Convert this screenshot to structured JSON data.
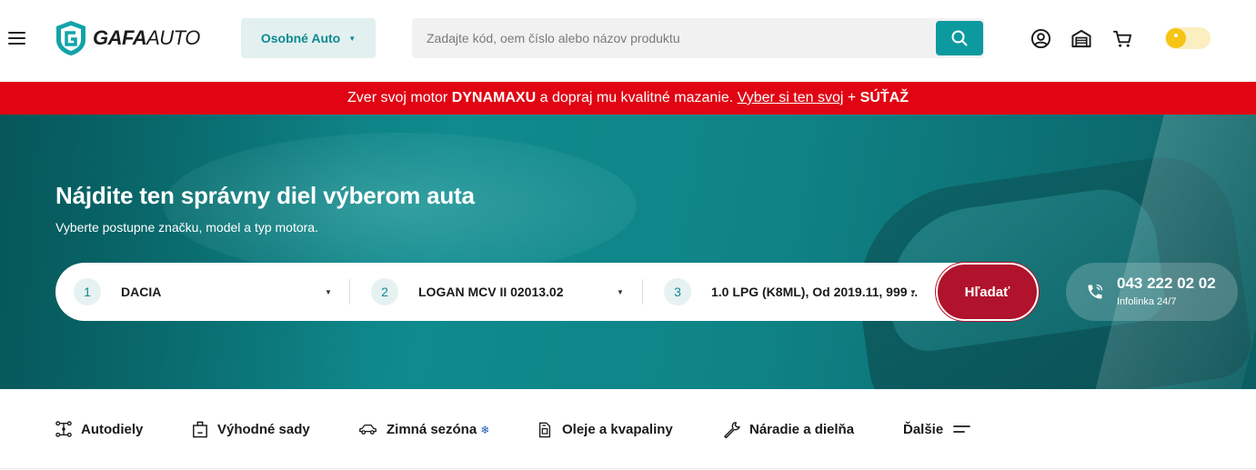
{
  "header": {
    "logo": {
      "bold": "GAFA",
      "thin": "AUTO"
    },
    "vehicle_type": "Osobné Auto",
    "search_placeholder": "Zadajte kód, oem číslo alebo názov produktu",
    "icons": [
      "menu-icon",
      "user-icon",
      "garage-icon",
      "cart-icon",
      "theme-toggle"
    ]
  },
  "promo": {
    "pre": "Zver svoj motor ",
    "brand": "DYNAMAXU",
    "mid": " a dopraj mu kvalitné mazanie. ",
    "link": "Vyber si ten svoj",
    "plus": " + ",
    "contest": "SÚŤAŽ"
  },
  "hero": {
    "title": "Nájdite ten správny diel výberom auta",
    "subtitle": "Vyberte postupne značku, model a typ motora.",
    "steps": [
      {
        "num": "1",
        "value": "DACIA"
      },
      {
        "num": "2",
        "value": "LOGAN MCV II 02013.02"
      },
      {
        "num": "3",
        "value": "1.0 LPG (K8ML), Od 2019.11, 999 ..."
      }
    ],
    "search_button": "Hľadať",
    "phone": {
      "number": "043 222 02 02",
      "label": "Infolinka 24/7"
    }
  },
  "categories": [
    {
      "label": "Autodiely",
      "icon": "parts-icon"
    },
    {
      "label": "Výhodné sady",
      "icon": "box-icon"
    },
    {
      "label": "Zimná sezóna",
      "icon": "car-icon"
    },
    {
      "label": "Oleje a kvapaliny",
      "icon": "oil-can-icon"
    },
    {
      "label": "Náradie a dielňa",
      "icon": "wrench-icon"
    },
    {
      "label": "Ďalšie",
      "icon": "more-lines-icon"
    }
  ],
  "colors": {
    "teal": "#0d9a9e",
    "promo_red": "#e10413",
    "search_red": "#b0132b",
    "toggle_yellow": "#f6c414"
  }
}
